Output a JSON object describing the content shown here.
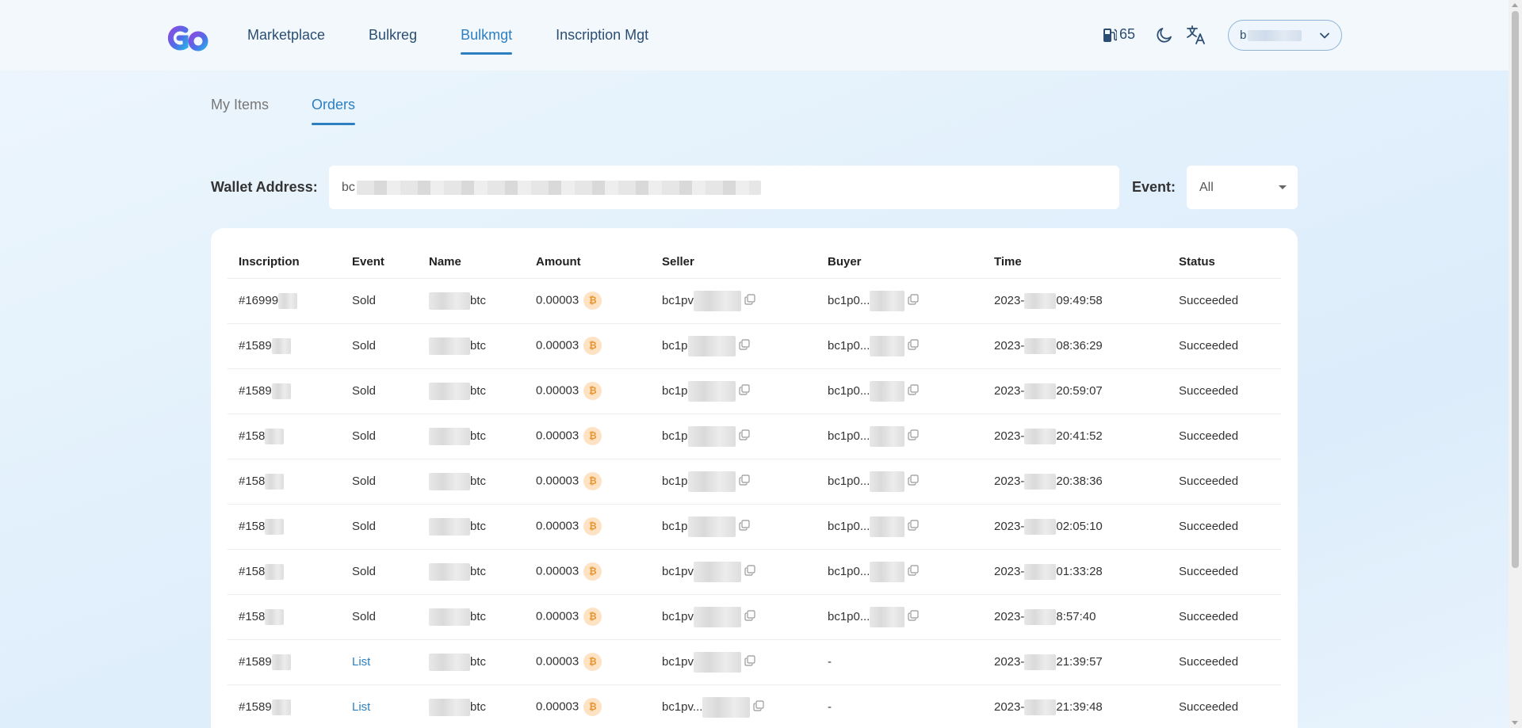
{
  "header": {
    "nav": [
      "Marketplace",
      "Bulkreg",
      "Bulkmgt",
      "Inscription Mgt"
    ],
    "active_nav": "Bulkmgt",
    "gas_value": "65",
    "account_prefix": "b"
  },
  "tabs": [
    "My Items",
    "Orders"
  ],
  "active_tab": "Orders",
  "filters": {
    "wallet_label": "Wallet Address:",
    "wallet_prefix": "bc",
    "event_label": "Event:",
    "event_value": "All"
  },
  "table": {
    "columns": [
      "Inscription",
      "Event",
      "Name",
      "Amount",
      "Seller",
      "Buyer",
      "Time",
      "Status"
    ],
    "rows": [
      {
        "inscription": "#16999",
        "event": "Sold",
        "name": "btc",
        "amount": "0.00003",
        "seller": "bc1pv",
        "buyer": "bc1p0...",
        "time_prefix": "2023-",
        "time_suffix": "09:49:58",
        "status": "Succeeded"
      },
      {
        "inscription": "#1589",
        "event": "Sold",
        "name": "btc",
        "amount": "0.00003",
        "seller": "bc1p",
        "buyer": "bc1p0...",
        "time_prefix": "2023-",
        "time_suffix": "08:36:29",
        "status": "Succeeded"
      },
      {
        "inscription": "#1589",
        "event": "Sold",
        "name": "btc",
        "amount": "0.00003",
        "seller": "bc1p",
        "buyer": "bc1p0...",
        "time_prefix": "2023-",
        "time_suffix": "20:59:07",
        "status": "Succeeded"
      },
      {
        "inscription": "#158",
        "event": "Sold",
        "name": "btc",
        "amount": "0.00003",
        "seller": "bc1p",
        "buyer": "bc1p0...",
        "time_prefix": "2023-",
        "time_suffix": "20:41:52",
        "status": "Succeeded"
      },
      {
        "inscription": "#158",
        "event": "Sold",
        "name": "btc",
        "amount": "0.00003",
        "seller": "bc1p",
        "buyer": "bc1p0...",
        "time_prefix": "2023-",
        "time_suffix": "20:38:36",
        "status": "Succeeded"
      },
      {
        "inscription": "#158",
        "event": "Sold",
        "name": "btc",
        "amount": "0.00003",
        "seller": "bc1p",
        "buyer": "bc1p0...",
        "time_prefix": "2023-",
        "time_suffix": "02:05:10",
        "status": "Succeeded"
      },
      {
        "inscription": "#158",
        "event": "Sold",
        "name": "btc",
        "amount": "0.00003",
        "seller": "bc1pv",
        "buyer": "bc1p0...",
        "time_prefix": "2023-",
        "time_suffix": "01:33:28",
        "status": "Succeeded"
      },
      {
        "inscription": "#158",
        "event": "Sold",
        "name": "btc",
        "amount": "0.00003",
        "seller": "bc1pv",
        "buyer": "bc1p0...",
        "time_prefix": "2023-",
        "time_suffix": "8:57:40",
        "status": "Succeeded"
      },
      {
        "inscription": "#1589",
        "event": "List",
        "name": "btc",
        "amount": "0.00003",
        "seller": "bc1pv",
        "buyer": "-",
        "time_prefix": "2023-",
        "time_suffix": "21:39:57",
        "status": "Succeeded"
      },
      {
        "inscription": "#1589",
        "event": "List",
        "name": "btc",
        "amount": "0.00003",
        "seller": "bc1pv...",
        "buyer": "-",
        "time_prefix": "2023-",
        "time_suffix": "21:39:48",
        "status": "Succeeded"
      }
    ]
  },
  "icons": {
    "logo": "gd-logo",
    "gas": "fuel-pump-icon",
    "theme": "moon-icon",
    "language": "translate-icon",
    "coin": "bitcoin-icon",
    "copy": "copy-icon"
  },
  "colors": {
    "accent": "#2d7fc1",
    "nav_text": "#2b4e72",
    "coin_bg": "#fde3c4",
    "coin_fg": "#e8942f"
  }
}
